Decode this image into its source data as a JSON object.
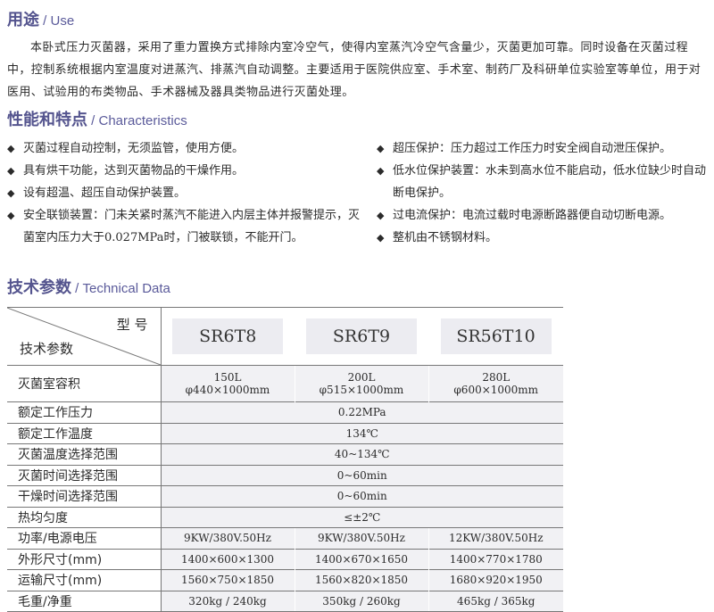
{
  "sections": {
    "use": {
      "cn": "用途",
      "en": " / Use"
    },
    "characteristics": {
      "cn": "性能和特点",
      "en": " / Characteristics"
    },
    "technical": {
      "cn": "技术参数",
      "en": " / Technical Data"
    }
  },
  "use_text": "本卧式压力灭菌器，采用了重力置换方式排除内室冷空气，使得内室蒸汽冷空气含量少，灭菌更加可靠。同时设备在灭菌过程中，控制系统根据内室温度对进蒸汽、排蒸汽自动调整。主要适用于医院供应室、手术室、制药厂及科研单位实验室等单位，用于对医用、试验用的布类物品、手术器械及器具类物品进行灭菌处理。",
  "features_left": [
    "灭菌过程自动控制，无须监管，使用方便。",
    "具有烘干功能，达到灭菌物品的干燥作用。",
    "设有超温、超压自动保护装置。",
    "安全联锁装置：门未关紧时蒸汽不能进入内层主体并报警提示，灭菌室内压力大于0.027MPa时，门被联锁，不能开门。"
  ],
  "features_right": [
    "超压保护：压力超过工作压力时安全阀自动泄压保护。",
    "低水位保护装置：水未到高水位不能启动，低水位缺少时自动断电保护。",
    "过电流保护：电流过载时电源断路器便自动切断电源。",
    "整机由不锈钢材料。"
  ],
  "bullet": "◆",
  "table": {
    "header_model": "型 号",
    "header_param": "技术参数",
    "models": [
      "SR6T8",
      "SR6T9",
      "SR56T10"
    ],
    "volume": {
      "label": "灭菌室容积",
      "values": [
        [
          "150L",
          "φ440×1000mm"
        ],
        [
          "200L",
          "φ515×1000mm"
        ],
        [
          "280L",
          "φ600×1000mm"
        ]
      ]
    },
    "shared_rows": [
      {
        "label": "额定工作压力",
        "value": "0.22MPa"
      },
      {
        "label": "额定工作温度",
        "value": "134℃"
      },
      {
        "label": "灭菌温度选择范围",
        "value": "40~134℃"
      },
      {
        "label": "灭菌时间选择范围",
        "value": "0~60min"
      },
      {
        "label": "干燥时间选择范围",
        "value": "0~60min"
      },
      {
        "label": "热均匀度",
        "value": "≤±2℃"
      }
    ],
    "model_rows": [
      {
        "label": "功率/电源电压",
        "values": [
          "9KW/380V.50Hz",
          "9KW/380V.50Hz",
          "12KW/380V.50Hz"
        ]
      },
      {
        "label": "外形尺寸(mm)",
        "values": [
          "1400×600×1300",
          "1400×670×1650",
          "1400×770×1780"
        ]
      },
      {
        "label": "运输尺寸(mm)",
        "values": [
          "1560×750×1850",
          "1560×820×1850",
          "1680×920×1950"
        ]
      },
      {
        "label": "毛重/净重",
        "values": [
          "320kg / 240kg",
          "350kg / 260kg",
          "465kg / 365kg"
        ]
      }
    ]
  }
}
